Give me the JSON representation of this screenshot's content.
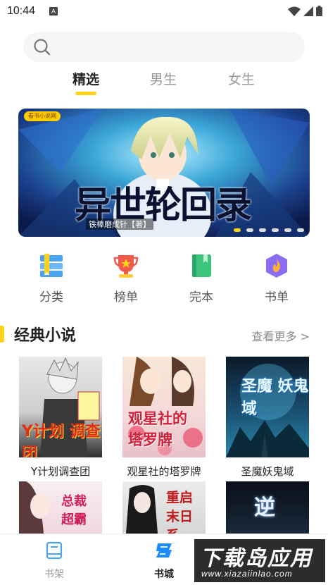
{
  "status_bar": {
    "time": "10:44",
    "notification_badge": "A"
  },
  "search": {
    "placeholder": ""
  },
  "tabs": [
    {
      "label": "精选",
      "active": true
    },
    {
      "label": "男生",
      "active": false
    },
    {
      "label": "女生",
      "active": false
    }
  ],
  "banner": {
    "logo_text": "看书小说网",
    "title": "异世轮回录",
    "subtitle": "铁棒磨成针【著】",
    "slides": 6,
    "active_slide": 1
  },
  "categories": [
    {
      "label": "分类",
      "icon": "list-icon",
      "color": "#4aa3f0"
    },
    {
      "label": "榜单",
      "icon": "trophy-icon",
      "color": "#f05a4a"
    },
    {
      "label": "完本",
      "icon": "book-icon",
      "color": "#3cc47c"
    },
    {
      "label": "书单",
      "icon": "booklist-icon",
      "color": "#8a6cf0"
    }
  ],
  "section": {
    "title": "经典小说",
    "more": "查看更多 >"
  },
  "books": [
    {
      "title": "Y计划调查团",
      "cover_text": "Y计划 调查团"
    },
    {
      "title": "观星社的塔罗牌",
      "cover_text": "观星社的 塔罗牌"
    },
    {
      "title": "圣魔妖鬼域",
      "cover_text": "圣魔 妖鬼域"
    },
    {
      "title": "",
      "cover_text": "总裁 超霸"
    },
    {
      "title": "",
      "cover_text": "重启 末日系"
    },
    {
      "title": "",
      "cover_text": "逆"
    }
  ],
  "bottom_nav": [
    {
      "label": "书架",
      "active": false
    },
    {
      "label": "书城",
      "active": true
    }
  ],
  "watermark": {
    "main": "下载岛应用",
    "sub": "www.xiazaiinlao.com"
  },
  "colors": {
    "accent": "#ffd21a",
    "active_nav": "#1a8cff"
  }
}
